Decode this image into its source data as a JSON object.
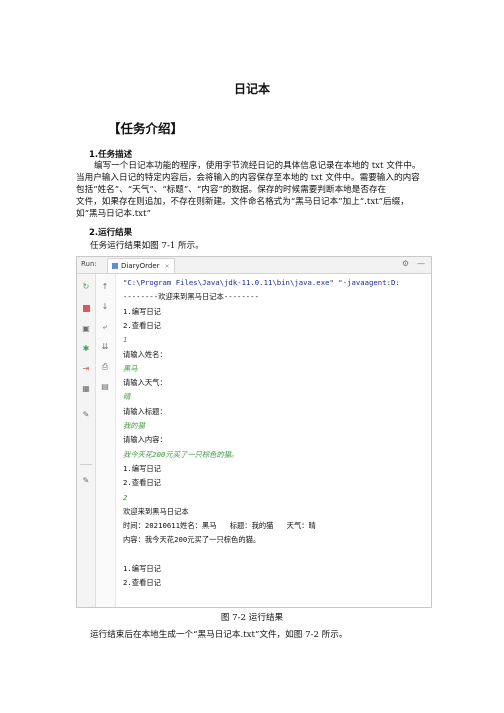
{
  "doc": {
    "title": "日记本",
    "section_heading": "【任务介绍】",
    "sub1_heading": "1.任务描述",
    "sub1_lines": [
      "编写一个日记本功能的程序，使用字节流经日记的具体信息记录在本地的 txt 文件中。",
      "当用户输入日记的特定内容后，会将输入的内容保存至本地的 txt 文件中。需要输入的内容",
      "包括“姓名”、“天气”、“标题”、“内容”的数据。保存的时候需要判断本地是否存在",
      "文件，如果存在则追加，不存在则新建。文件命名格式为“黑马日记本”加上“.txt”后缀，",
      "如“黑马日记本.txt”"
    ],
    "sub2_heading": "2.运行结果",
    "run_intro": "任务运行结果如图 7-1 所示。",
    "figure_caption": "图 7-2  运行结果",
    "after_text": "运行结束后在本地生成一个“黑马日记本.txt”文件，如图 7-2 所示。"
  },
  "ide": {
    "run_label": "Run:",
    "tab_label": "DiaryOrder",
    "tab_close": "×",
    "gear": "⚙",
    "minimize": "—",
    "toolbar_icons": [
      "rerun-icon",
      "stop-icon",
      "camera-icon",
      "debug-icon",
      "login-icon",
      "layout-icon",
      "pin-icon",
      "pin2-icon"
    ],
    "toolbar2_icons": [
      "up-arrow-icon",
      "down-arrow-icon",
      "soft-wrap-icon",
      "scroll-end-icon",
      "print-icon",
      "trash-icon"
    ],
    "console_lines": [
      {
        "text": "\"C:\\Program Files\\Java\\jdk-11.0.11\\bin\\java.exe\" \"-javaagent:D:",
        "kind": "cmd"
      },
      {
        "text": "--------欢迎来到黑马日记本--------",
        "kind": "out"
      },
      {
        "text": "1.编写日记",
        "kind": "out"
      },
      {
        "text": "2.查看日记",
        "kind": "out"
      },
      {
        "text": "1",
        "kind": "inp"
      },
      {
        "text": "请输入姓名：",
        "kind": "out"
      },
      {
        "text": "黑马",
        "kind": "inp"
      },
      {
        "text": "请输入天气：",
        "kind": "out"
      },
      {
        "text": "晴",
        "kind": "inp"
      },
      {
        "text": "请输入标题：",
        "kind": "out"
      },
      {
        "text": "我的猫",
        "kind": "inp"
      },
      {
        "text": "请输入内容：",
        "kind": "out"
      },
      {
        "text": "我今天花200元买了一只棕色的猫。",
        "kind": "inp"
      },
      {
        "text": "1.编写日记",
        "kind": "out"
      },
      {
        "text": "2.查看日记",
        "kind": "out"
      },
      {
        "text": "2",
        "kind": "inp"
      },
      {
        "text": "欢迎来到黑马日记本",
        "kind": "out"
      },
      {
        "text": "时间：20210611姓名：黑马   标题：我的猫   天气：晴",
        "kind": "out"
      },
      {
        "text": "内容：我今天花200元买了一只棕色的猫。",
        "kind": "out"
      },
      {
        "text": "",
        "kind": "out"
      },
      {
        "text": "1.编写日记",
        "kind": "out"
      },
      {
        "text": "2.查看日记",
        "kind": "out"
      }
    ]
  }
}
